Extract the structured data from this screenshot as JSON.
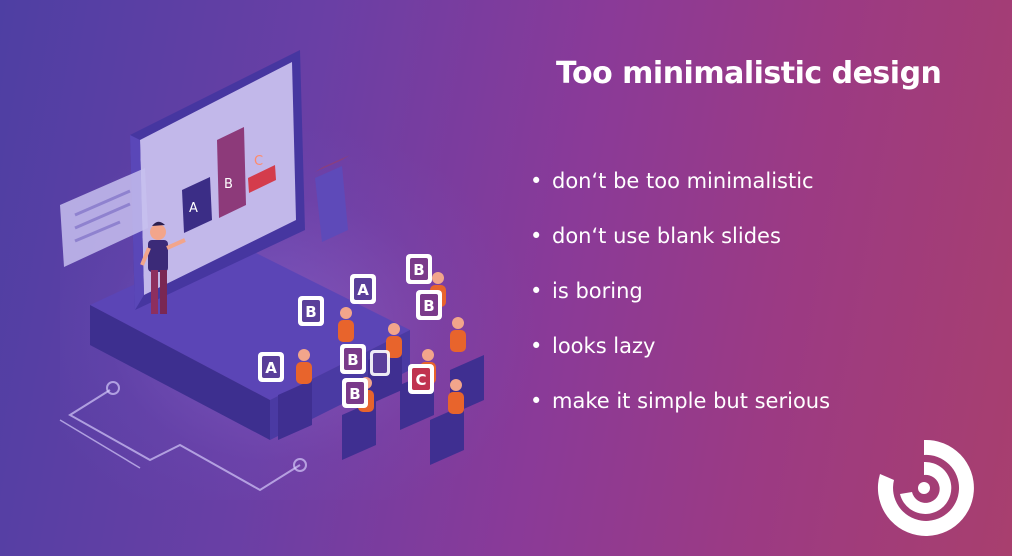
{
  "slide": {
    "title": "Too minimalistic design",
    "bullets": [
      "don‘t be too minimalistic",
      "don‘t use blank slides",
      "is boring",
      "looks lazy",
      "make it simple but serious"
    ]
  },
  "illustration": {
    "screen_chart_letters": [
      "A",
      "B",
      "C"
    ],
    "audience_cards": [
      "B",
      "A",
      "B",
      "B",
      "B",
      "A",
      "B",
      "C",
      "B"
    ]
  },
  "colors": {
    "gradient_start": "#4e3fa3",
    "gradient_end": "#a83f6e",
    "text": "#ffffff",
    "accent_orange": "#e8642c",
    "bar_red": "#c0334f",
    "logo": "#ffffff"
  },
  "icons": {
    "bullet": "bullet-dot",
    "logo": "spiral-logo-icon"
  }
}
